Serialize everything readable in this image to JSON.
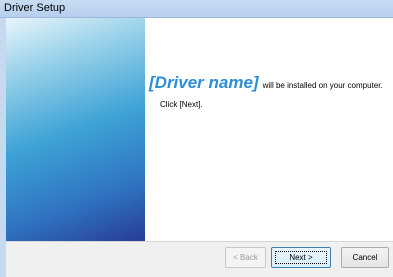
{
  "window": {
    "title": "Driver Setup"
  },
  "content": {
    "driver_name": "[Driver name]",
    "headline_rest": "will be installed on your computer.",
    "instruction": "Click [Next]."
  },
  "buttons": {
    "back_label": "< Back",
    "next_label": "Next >",
    "cancel_label": "Cancel"
  },
  "colors": {
    "accent": "#2d8ed8",
    "titlebar": "#b7cfee",
    "banner_top": "#e8f5fb",
    "banner_bottom": "#283c96"
  }
}
